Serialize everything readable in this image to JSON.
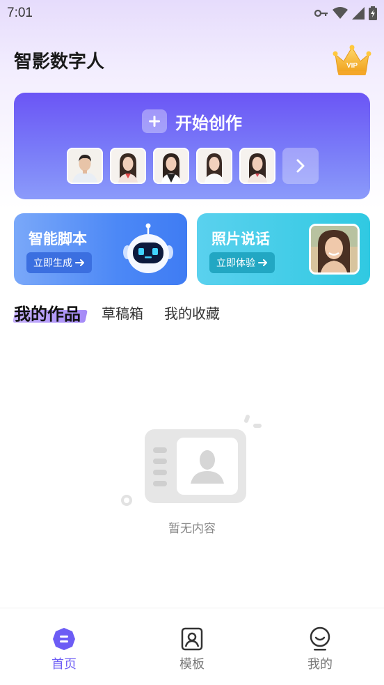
{
  "status_bar": {
    "time": "7:01",
    "icons": [
      "vpn-key-icon",
      "wifi-icon",
      "signal-icon",
      "battery-charging-icon"
    ]
  },
  "header": {
    "title": "智影数字人",
    "vip_label": "VIP"
  },
  "create_card": {
    "label": "开始创作",
    "avatars": [
      "male-avatar",
      "female-avatar-1",
      "female-avatar-2",
      "female-avatar-3",
      "female-avatar-4"
    ]
  },
  "feature_cards": {
    "script": {
      "title": "智能脚本",
      "button": "立即生成"
    },
    "photo": {
      "title": "照片说话",
      "button": "立即体验"
    }
  },
  "tabs": [
    {
      "label": "我的作品",
      "active": true
    },
    {
      "label": "草稿箱",
      "active": false
    },
    {
      "label": "我的收藏",
      "active": false
    }
  ],
  "empty_state": {
    "text": "暂无内容"
  },
  "bottom_nav": [
    {
      "label": "首页",
      "icon": "home-icon",
      "active": true
    },
    {
      "label": "模板",
      "icon": "template-icon",
      "active": false
    },
    {
      "label": "我的",
      "icon": "profile-icon",
      "active": false
    }
  ],
  "colors": {
    "accent": "#6c5cf5",
    "create_card": "#6b55f5",
    "script_card": "#4c88f6",
    "photo_card": "#30c9e2"
  }
}
